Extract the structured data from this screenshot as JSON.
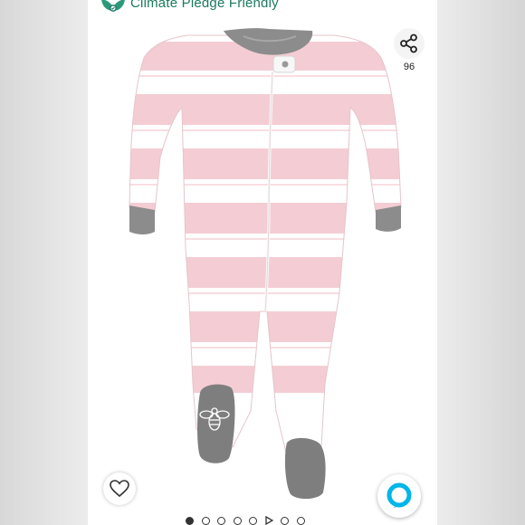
{
  "banner": {
    "label": "Climate Pledge Friendly",
    "icon": "climate-pledge-leaf-icon",
    "color": "#1b7a62"
  },
  "product_image": {
    "subject": "pink-and-white-striped-footed-sleeper",
    "colors": {
      "stripe_pink": "#f4cdd4",
      "stripe_white": "#ffffff",
      "trim_gray": "#8c8c8c"
    }
  },
  "share": {
    "icon": "share-icon",
    "count": "96"
  },
  "wishlist": {
    "icon": "heart-icon"
  },
  "assistant": {
    "icon": "alexa-ring-icon",
    "color": "#00caff"
  },
  "carousel": {
    "total_dots": 9,
    "active_index": 0,
    "video_index": 5
  }
}
